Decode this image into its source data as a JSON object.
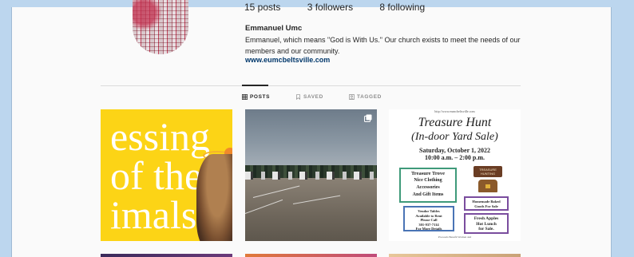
{
  "profile": {
    "stats": [
      "15 posts",
      "3 followers",
      "8 following"
    ],
    "name": "Emmanuel Umc",
    "bio": "Emmanuel, which means \"God is With Us.\" Our church exists to meet the needs of our members and our community.",
    "website": "www.eumcbeltsville.com"
  },
  "tabs": [
    {
      "label": "POSTS",
      "icon": "grid-icon",
      "active": true
    },
    {
      "label": "SAVED",
      "icon": "bookmark-icon",
      "active": false
    },
    {
      "label": "TAGGED",
      "icon": "tag-icon",
      "active": false
    }
  ],
  "posts": {
    "post1": {
      "lines": [
        "essing",
        "of the",
        "imals"
      ]
    },
    "post2": {
      "icon": "multiple-images-icon"
    },
    "post3": {
      "url": "http://www.eumcbeltsville.com",
      "title_line1": "Treasure Hunt",
      "title_line2": "(In-door Yard Sale)",
      "date": "Saturday, October 1, 2022",
      "time": "10:00 a.m. – 2:00 p.m.",
      "box1_title": "Treasure Trove",
      "box1_lines": [
        "Nice Clothing",
        "Accessories",
        "And Gift Items"
      ],
      "sign_lines": [
        "TREASURE",
        "HUNTING"
      ],
      "box2_lines": [
        "Vendor Tables",
        "Available to Rent",
        "Please Call",
        "301-937-7114",
        "For More Details"
      ],
      "box3_lines": [
        "Homemade Baked",
        "Goods For Sale"
      ],
      "box4_lines": [
        "Fresh Apples",
        "Hot Lunch",
        "for Sale."
      ],
      "footer": "Proceeds Benefit Women and"
    }
  },
  "colors": {
    "page_bg": "#bcd6ee",
    "link": "#00376b",
    "post1_bg": "#fcd416"
  }
}
